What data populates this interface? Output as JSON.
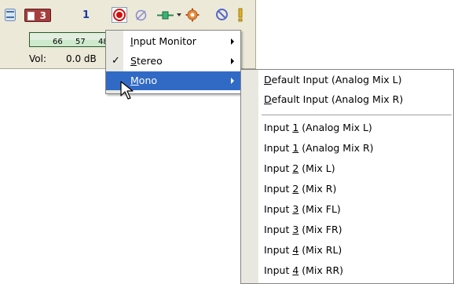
{
  "track": {
    "number": "1",
    "color_label": "3",
    "meter_labels": [
      "66",
      "57",
      "48"
    ],
    "vol_label": "Vol:",
    "vol_value": "0.0 dB"
  },
  "menu": {
    "items": [
      {
        "label": "Input Monitor",
        "accel": "I",
        "rest": "nput Monitor",
        "submenu": true,
        "checked": false
      },
      {
        "label": "Stereo",
        "accel": "S",
        "rest": "tereo",
        "submenu": true,
        "checked": true
      },
      {
        "label": "Mono",
        "accel": "M",
        "rest": "ono",
        "submenu": true,
        "checked": false,
        "highlighted": true
      }
    ]
  },
  "submenu": {
    "default_items": [
      {
        "pre": "",
        "accel": "D",
        "rest": "efault Input (Analog Mix L)"
      },
      {
        "pre": "",
        "accel": "D",
        "rest": "efault Input (Analog Mix R)"
      }
    ],
    "input_items": [
      {
        "pre": "Input ",
        "accel": "1",
        "rest": " (Analog Mix L)"
      },
      {
        "pre": "Input ",
        "accel": "1",
        "rest": " (Analog Mix R)"
      },
      {
        "pre": "Input ",
        "accel": "2",
        "rest": " (Mix L)"
      },
      {
        "pre": "Input ",
        "accel": "2",
        "rest": " (Mix R)"
      },
      {
        "pre": "Input ",
        "accel": "3",
        "rest": " (Mix FL)"
      },
      {
        "pre": "Input ",
        "accel": "3",
        "rest": " (Mix FR)"
      },
      {
        "pre": "Input ",
        "accel": "4",
        "rest": " (Mix RL)"
      },
      {
        "pre": "Input ",
        "accel": "4",
        "rest": " (Mix RR)"
      }
    ]
  },
  "colors": {
    "highlight": "#316ac5",
    "track_bg": "#ece9d8",
    "track_color": "#a83d3d",
    "meter_green": "#3c8c3c"
  },
  "icons": [
    "minimize-icon",
    "arm-record-icon",
    "link-icon",
    "insert-icon",
    "fx-icon",
    "mute-icon",
    "solo-icon",
    "check-icon",
    "submenu-arrow-icon",
    "mouse-pointer-icon"
  ]
}
